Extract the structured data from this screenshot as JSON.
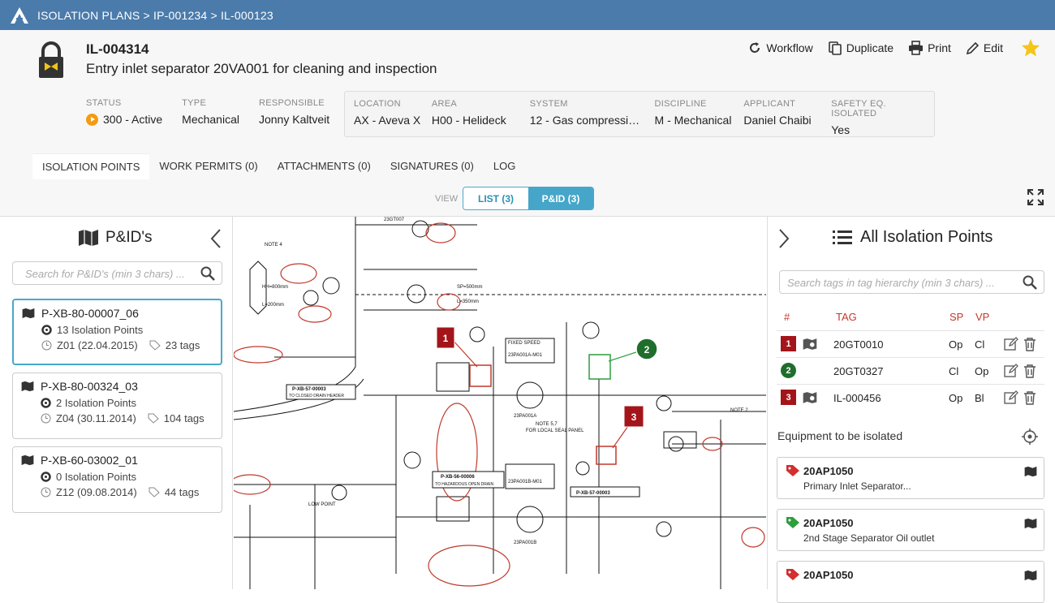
{
  "breadcrumb": "ISOLATION PLANS > IP-001234 > IL-000123",
  "plan": {
    "id": "IL-004314",
    "title": "Entry inlet separator 20VA001 for cleaning and inspection"
  },
  "actions": {
    "workflow": "Workflow",
    "duplicate": "Duplicate",
    "print": "Print",
    "edit": "Edit"
  },
  "meta": {
    "status": {
      "label": "STATUS",
      "value": "300 - Active"
    },
    "type": {
      "label": "TYPE",
      "value": "Mechanical"
    },
    "responsible": {
      "label": "RESPONSIBLE",
      "value": "Jonny Kaltveit"
    },
    "location": {
      "label": "LOCATION",
      "value": "AX - Aveva X"
    },
    "area": {
      "label": "AREA",
      "value": "H00 - Helideck"
    },
    "system": {
      "label": "SYSTEM",
      "value": "12 - Gas compressi…"
    },
    "discipline": {
      "label": "DISCIPLINE",
      "value": "M - Mechanical"
    },
    "applicant": {
      "label": "APPLICANT",
      "value": "Daniel Chaibi"
    },
    "safety": {
      "label": "SAFETY EQ. ISOLATED",
      "value": "Yes"
    }
  },
  "tabs": [
    "ISOLATION POINTS",
    "WORK PERMITS (0)",
    "ATTACHMENTS (0)",
    "SIGNATURES (0)",
    "LOG"
  ],
  "view": {
    "label": "VIEW",
    "list": "LIST (3)",
    "pid": "P&ID (3)"
  },
  "left": {
    "title": "P&ID's",
    "search_placeholder": "Search for P&ID's (min 3 chars) ...",
    "cards": [
      {
        "name": "P-XB-80-00007_06",
        "points": "13 Isolation Points",
        "date": "Z01 (22.04.2015)",
        "tags": "23 tags"
      },
      {
        "name": "P-XB-80-00324_03",
        "points": "2 Isolation Points",
        "date": "Z04 (30.11.2014)",
        "tags": "104 tags"
      },
      {
        "name": "P-XB-60-03002_01",
        "points": "0 Isolation Points",
        "date": "Z12 (09.08.2014)",
        "tags": "44 tags"
      }
    ]
  },
  "diagram": {
    "markers": [
      "1",
      "2",
      "3"
    ],
    "labels": [
      "NOTE 4",
      "23GT007",
      "P-XB-57-00003",
      "TO CLOSED DRAIN HEADER",
      "FIXED SPEED",
      "23PA001A-M01",
      "23PA001A",
      "NOTE 5,7",
      "FOR LOCAL SEAL PANEL",
      "P-XB-56-00006",
      "TO HAZARDOUS OPEN DRAIN",
      "23PA001B-M01",
      "23PA001B",
      "NOTE 2",
      "LOW POINT",
      "P-XB-57-00003",
      "SP=500mm",
      "L=350mm",
      "HH=800mm",
      "L=200mm"
    ]
  },
  "right": {
    "title": "All Isolation Points",
    "search_placeholder": "Search tags in tag hierarchy (min 3 chars) ...",
    "columns": {
      "num": "#",
      "tag": "TAG",
      "sp": "SP",
      "vp": "VP"
    },
    "rows": [
      {
        "num": "1",
        "tag": "20GT0010",
        "sp": "Op",
        "vp": "Cl"
      },
      {
        "num": "2",
        "tag": "20GT0327",
        "sp": "Cl",
        "vp": "Op"
      },
      {
        "num": "3",
        "tag": "IL-000456",
        "sp": "Op",
        "vp": "Bl"
      }
    ],
    "equip_title": "Equipment to be isolated",
    "equipment": [
      {
        "tag": "20AP1050",
        "desc": "Primary Inlet Separator...",
        "color": "#d32f2f"
      },
      {
        "tag": "20AP1050",
        "desc": "2nd Stage Separator Oil outlet",
        "color": "#2e9e3e"
      },
      {
        "tag": "20AP1050",
        "desc": "",
        "color": "#d32f2f"
      }
    ]
  }
}
